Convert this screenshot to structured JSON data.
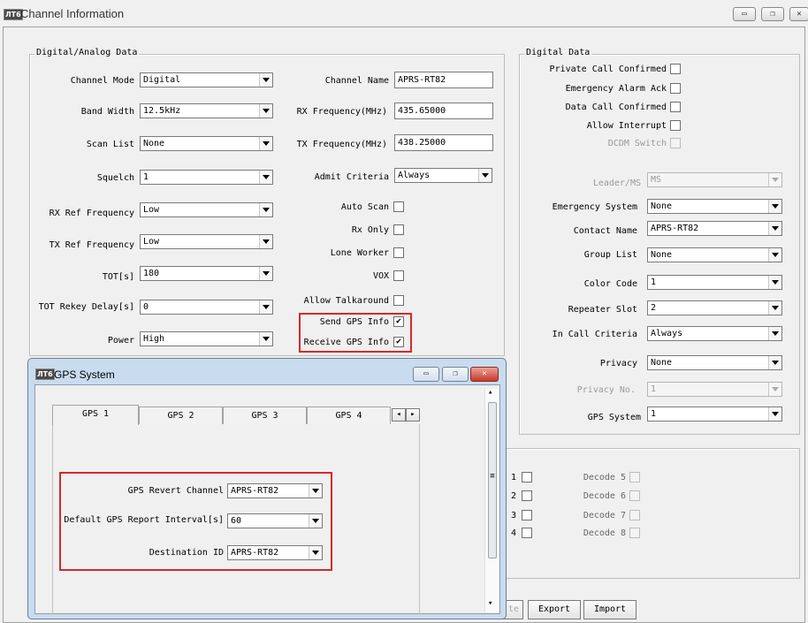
{
  "window": {
    "icon": "ЛТ6",
    "title": "Channel Information",
    "buttons": {
      "minimize": "▭",
      "restore": "❐",
      "close": "✕"
    }
  },
  "digital_analog": {
    "legend": "Digital/Analog Data",
    "channel_mode": {
      "label": "Channel Mode",
      "value": "Digital"
    },
    "band_width": {
      "label": "Band Width",
      "value": "12.5kHz"
    },
    "scan_list": {
      "label": "Scan List",
      "value": "None"
    },
    "squelch": {
      "label": "Squelch",
      "value": "1"
    },
    "rx_ref": {
      "label": "RX Ref Frequency",
      "value": "Low"
    },
    "tx_ref": {
      "label": "TX Ref Frequency",
      "value": "Low"
    },
    "tot": {
      "label": "TOT[s]",
      "value": "180"
    },
    "tot_rekey": {
      "label": "TOT Rekey Delay[s]",
      "value": "0"
    },
    "power": {
      "label": "Power",
      "value": "High"
    },
    "channel_name": {
      "label": "Channel Name",
      "value": "APRS-RT82"
    },
    "rx_freq": {
      "label": "RX Frequency(MHz)",
      "value": "435.65000"
    },
    "tx_freq": {
      "label": "TX Frequency(MHz)",
      "value": "438.25000"
    },
    "admit": {
      "label": "Admit Criteria",
      "value": "Always"
    },
    "auto_scan": {
      "label": "Auto Scan",
      "checked": ""
    },
    "rx_only": {
      "label": "Rx Only",
      "checked": ""
    },
    "lone_worker": {
      "label": "Lone Worker",
      "checked": ""
    },
    "vox": {
      "label": "VOX",
      "checked": ""
    },
    "allow_talkaround": {
      "label": "Allow Talkaround",
      "checked": ""
    },
    "send_gps": {
      "label": "Send GPS Info",
      "checked": "✔"
    },
    "receive_gps": {
      "label": "Receive GPS Info",
      "checked": "✔"
    }
  },
  "digital": {
    "legend": "Digital Data",
    "private_call": {
      "label": "Private Call Confirmed",
      "checked": ""
    },
    "emergency_ack": {
      "label": "Emergency Alarm Ack",
      "checked": ""
    },
    "data_call": {
      "label": "Data Call Confirmed",
      "checked": ""
    },
    "allow_interrupt": {
      "label": "Allow Interrupt",
      "checked": ""
    },
    "dcdm": {
      "label": "DCDM Switch",
      "checked": ""
    },
    "leader": {
      "label": "Leader/MS",
      "value": "MS"
    },
    "emergency_system": {
      "label": "Emergency System",
      "value": "None"
    },
    "contact_name": {
      "label": "Contact Name",
      "value": "APRS-RT82"
    },
    "group_list": {
      "label": "Group List",
      "value": "None"
    },
    "color_code": {
      "label": "Color Code",
      "value": "1"
    },
    "repeater_slot": {
      "label": "Repeater Slot",
      "value": "2"
    },
    "in_call": {
      "label": "In Call Criteria",
      "value": "Always"
    },
    "privacy": {
      "label": "Privacy",
      "value": "None"
    },
    "privacy_no": {
      "label": "Privacy No.",
      "value": "1"
    },
    "gps_system": {
      "label": "GPS System",
      "value": "1"
    }
  },
  "decode": {
    "left": [
      "1",
      "2",
      "3",
      "4"
    ],
    "right": [
      "Decode 5",
      "Decode 6",
      "Decode 7",
      "Decode 8"
    ]
  },
  "bottom_buttons": {
    "partial": "te",
    "export": "Export",
    "import": "Import"
  },
  "gps_popup": {
    "icon": "ЛТ6",
    "title": "GPS System",
    "buttons": {
      "minimize": "▭",
      "restore": "❐",
      "close": "✕"
    },
    "tabs": [
      "GPS 1",
      "GPS 2",
      "GPS 3",
      "GPS 4"
    ],
    "tab_nav": {
      "prev": "◂",
      "next": "▸"
    },
    "revert_channel": {
      "label": "GPS Revert Channel",
      "value": "APRS-RT82"
    },
    "report_interval": {
      "label": "Default GPS Report Interval[s]",
      "value": "60"
    },
    "destination": {
      "label": "Destination ID",
      "value": "APRS-RT82"
    },
    "scroll": {
      "up": "▴",
      "down": "▾",
      "grip": "≡"
    }
  },
  "colors": {
    "highlight": "#d42a2a",
    "popup_frame": "#c9dcef"
  }
}
